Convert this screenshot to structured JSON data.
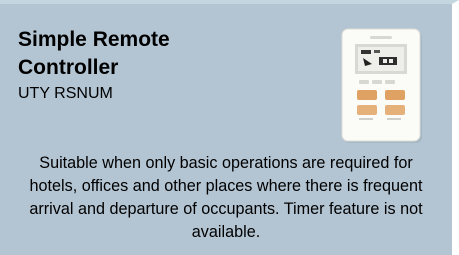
{
  "card": {
    "title": "Simple Remote Controller",
    "model": "UTY RSNUM",
    "description": "Suitable when only basic operations are required for hotels, offices and other places where there is frequent arrival and departure of occupants.  Timer feature is not available."
  },
  "colors": {
    "card_background": "#b3c4d2",
    "top_border": "#c4d6e0",
    "text": "#000000",
    "button_accent": "#e0a262"
  },
  "icons": {
    "product": "remote-controller-image"
  }
}
